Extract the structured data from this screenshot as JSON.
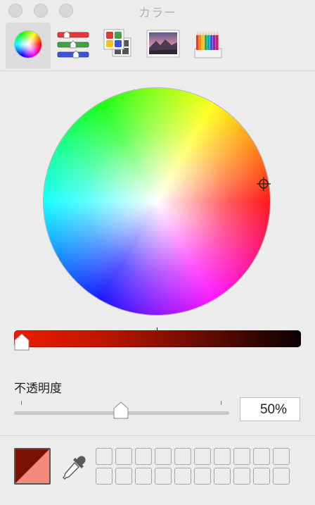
{
  "window": {
    "title": "カラー",
    "buttons": [
      "close-button",
      "minimize-button",
      "zoom-button"
    ]
  },
  "toolbar": {
    "tabs": [
      {
        "name": "color-wheel",
        "icon": "color-wheel-icon",
        "active": true
      },
      {
        "name": "color-sliders",
        "icon": "sliders-icon",
        "active": false
      },
      {
        "name": "color-palettes",
        "icon": "palettes-icon",
        "active": false
      },
      {
        "name": "image-palettes",
        "icon": "image-icon",
        "active": false
      },
      {
        "name": "pencils",
        "icon": "pencils-icon",
        "active": false
      }
    ]
  },
  "picker": {
    "brightness": 1.0
  },
  "opacity": {
    "label": "不透明度",
    "value": "50%",
    "level": 0.5
  },
  "colors": {
    "current": "#7a1200",
    "previous": "#f4887a",
    "active_tab_bg": "#dcdcdc"
  },
  "swatch_slots": {
    "rows": 2,
    "columns": 10
  }
}
